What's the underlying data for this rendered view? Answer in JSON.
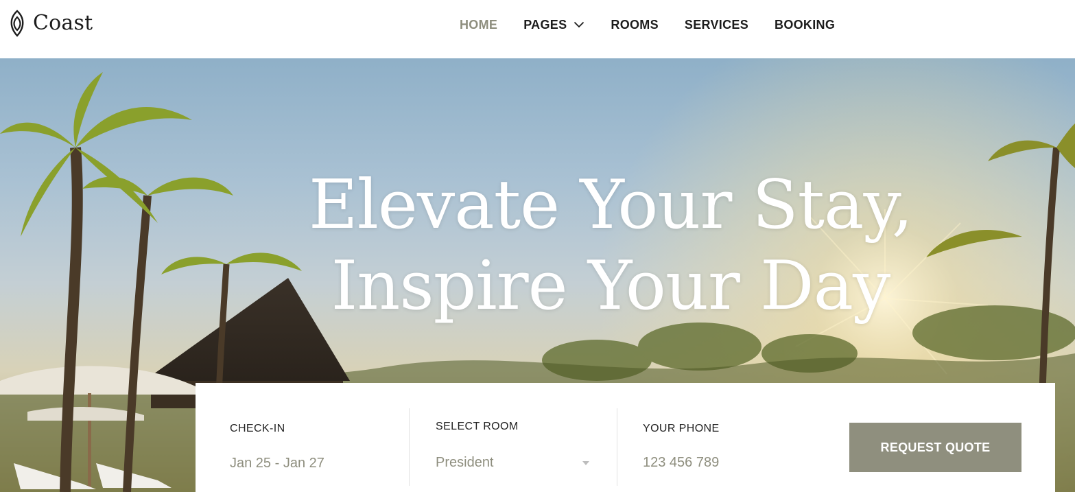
{
  "brand": {
    "name": "Coast",
    "icon": "leaf-logo-icon"
  },
  "nav": {
    "items": [
      {
        "label": "HOME",
        "active": true
      },
      {
        "label": "PAGES",
        "has_dropdown": true
      },
      {
        "label": "ROOMS"
      },
      {
        "label": "SERVICES"
      },
      {
        "label": "BOOKING"
      }
    ]
  },
  "hero": {
    "headline_line1": "Elevate Your Stay,",
    "headline_line2": "Inspire Your Day"
  },
  "booking": {
    "checkin": {
      "label": "CHECK-IN",
      "value": "Jan 25 - Jan 27"
    },
    "room": {
      "label": "SELECT ROOM",
      "value": "President"
    },
    "phone": {
      "label": "YOUR PHONE",
      "placeholder": "123 456 789"
    },
    "button_label": "REQUEST QUOTE"
  },
  "colors": {
    "accent": "#8f8f7e",
    "active_nav": "#8e8e7e",
    "text": "#1c1c1c"
  }
}
